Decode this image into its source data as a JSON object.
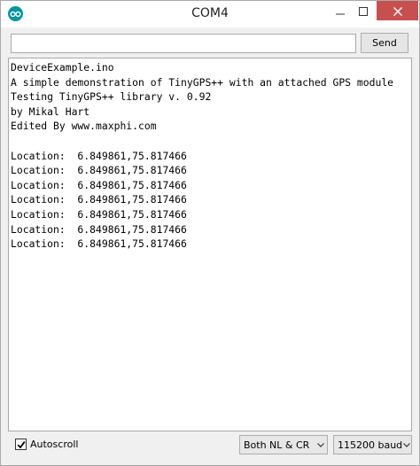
{
  "window": {
    "title": "COM4",
    "app_icon": "arduino-infinity-icon",
    "controls": {
      "minimize_icon": "minimize-icon",
      "maximize_icon": "maximize-icon",
      "close_icon": "close-icon"
    }
  },
  "send_bar": {
    "input_value": "",
    "input_placeholder": "",
    "send_label": "Send"
  },
  "output": {
    "lines": [
      "DeviceExample.ino",
      "A simple demonstration of TinyGPS++ with an attached GPS module",
      "Testing TinyGPS++ library v. 0.92",
      "by Mikal Hart",
      "Edited By www.maxphi.com",
      "",
      "Location:  6.849861,75.817466",
      "Location:  6.849861,75.817466",
      "Location:  6.849861,75.817466",
      "Location:  6.849861,75.817466",
      "Location:  6.849861,75.817466",
      "Location:  6.849861,75.817466",
      "Location:  6.849861,75.817466"
    ]
  },
  "footer": {
    "autoscroll_label": "Autoscroll",
    "autoscroll_checked": true,
    "line_ending_value": "Both NL & CR",
    "baud_value": "115200 baud"
  },
  "colors": {
    "close_button": "#c7504f",
    "app_icon": "#00979c",
    "window_bg": "#f0f0f0",
    "output_bg": "#ffffff"
  }
}
